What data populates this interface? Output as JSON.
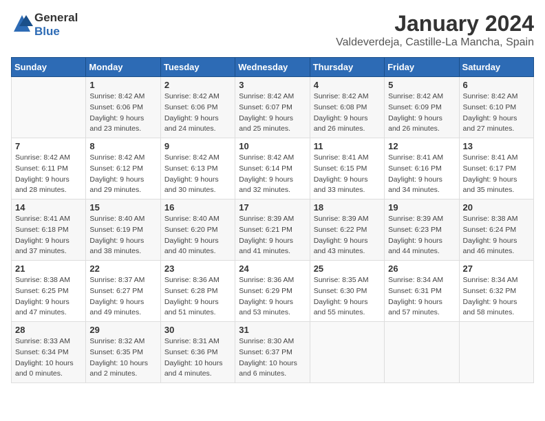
{
  "logo": {
    "text_general": "General",
    "text_blue": "Blue"
  },
  "title": "January 2024",
  "subtitle": "Valdeverdeja, Castille-La Mancha, Spain",
  "days_of_week": [
    "Sunday",
    "Monday",
    "Tuesday",
    "Wednesday",
    "Thursday",
    "Friday",
    "Saturday"
  ],
  "weeks": [
    [
      {
        "day": "",
        "sunrise": "",
        "sunset": "",
        "daylight": ""
      },
      {
        "day": "1",
        "sunrise": "Sunrise: 8:42 AM",
        "sunset": "Sunset: 6:06 PM",
        "daylight": "Daylight: 9 hours and 23 minutes."
      },
      {
        "day": "2",
        "sunrise": "Sunrise: 8:42 AM",
        "sunset": "Sunset: 6:06 PM",
        "daylight": "Daylight: 9 hours and 24 minutes."
      },
      {
        "day": "3",
        "sunrise": "Sunrise: 8:42 AM",
        "sunset": "Sunset: 6:07 PM",
        "daylight": "Daylight: 9 hours and 25 minutes."
      },
      {
        "day": "4",
        "sunrise": "Sunrise: 8:42 AM",
        "sunset": "Sunset: 6:08 PM",
        "daylight": "Daylight: 9 hours and 26 minutes."
      },
      {
        "day": "5",
        "sunrise": "Sunrise: 8:42 AM",
        "sunset": "Sunset: 6:09 PM",
        "daylight": "Daylight: 9 hours and 26 minutes."
      },
      {
        "day": "6",
        "sunrise": "Sunrise: 8:42 AM",
        "sunset": "Sunset: 6:10 PM",
        "daylight": "Daylight: 9 hours and 27 minutes."
      }
    ],
    [
      {
        "day": "7",
        "sunrise": "",
        "sunset": "",
        "daylight": ""
      },
      {
        "day": "8",
        "sunrise": "Sunrise: 8:42 AM",
        "sunset": "Sunset: 6:12 PM",
        "daylight": "Daylight: 9 hours and 29 minutes."
      },
      {
        "day": "9",
        "sunrise": "Sunrise: 8:42 AM",
        "sunset": "Sunset: 6:13 PM",
        "daylight": "Daylight: 9 hours and 30 minutes."
      },
      {
        "day": "10",
        "sunrise": "Sunrise: 8:42 AM",
        "sunset": "Sunset: 6:14 PM",
        "daylight": "Daylight: 9 hours and 32 minutes."
      },
      {
        "day": "11",
        "sunrise": "Sunrise: 8:41 AM",
        "sunset": "Sunset: 6:15 PM",
        "daylight": "Daylight: 9 hours and 33 minutes."
      },
      {
        "day": "12",
        "sunrise": "Sunrise: 8:41 AM",
        "sunset": "Sunset: 6:16 PM",
        "daylight": "Daylight: 9 hours and 34 minutes."
      },
      {
        "day": "13",
        "sunrise": "Sunrise: 8:41 AM",
        "sunset": "Sunset: 6:17 PM",
        "daylight": "Daylight: 9 hours and 35 minutes."
      }
    ],
    [
      {
        "day": "14",
        "sunrise": "Sunrise: 8:41 AM",
        "sunset": "Sunset: 6:18 PM",
        "daylight": "Daylight: 9 hours and 37 minutes."
      },
      {
        "day": "15",
        "sunrise": "Sunrise: 8:40 AM",
        "sunset": "Sunset: 6:19 PM",
        "daylight": "Daylight: 9 hours and 38 minutes."
      },
      {
        "day": "16",
        "sunrise": "Sunrise: 8:40 AM",
        "sunset": "Sunset: 6:20 PM",
        "daylight": "Daylight: 9 hours and 40 minutes."
      },
      {
        "day": "17",
        "sunrise": "Sunrise: 8:39 AM",
        "sunset": "Sunset: 6:21 PM",
        "daylight": "Daylight: 9 hours and 41 minutes."
      },
      {
        "day": "18",
        "sunrise": "Sunrise: 8:39 AM",
        "sunset": "Sunset: 6:22 PM",
        "daylight": "Daylight: 9 hours and 43 minutes."
      },
      {
        "day": "19",
        "sunrise": "Sunrise: 8:39 AM",
        "sunset": "Sunset: 6:23 PM",
        "daylight": "Daylight: 9 hours and 44 minutes."
      },
      {
        "day": "20",
        "sunrise": "Sunrise: 8:38 AM",
        "sunset": "Sunset: 6:24 PM",
        "daylight": "Daylight: 9 hours and 46 minutes."
      }
    ],
    [
      {
        "day": "21",
        "sunrise": "Sunrise: 8:38 AM",
        "sunset": "Sunset: 6:25 PM",
        "daylight": "Daylight: 9 hours and 47 minutes."
      },
      {
        "day": "22",
        "sunrise": "Sunrise: 8:37 AM",
        "sunset": "Sunset: 6:27 PM",
        "daylight": "Daylight: 9 hours and 49 minutes."
      },
      {
        "day": "23",
        "sunrise": "Sunrise: 8:36 AM",
        "sunset": "Sunset: 6:28 PM",
        "daylight": "Daylight: 9 hours and 51 minutes."
      },
      {
        "day": "24",
        "sunrise": "Sunrise: 8:36 AM",
        "sunset": "Sunset: 6:29 PM",
        "daylight": "Daylight: 9 hours and 53 minutes."
      },
      {
        "day": "25",
        "sunrise": "Sunrise: 8:35 AM",
        "sunset": "Sunset: 6:30 PM",
        "daylight": "Daylight: 9 hours and 55 minutes."
      },
      {
        "day": "26",
        "sunrise": "Sunrise: 8:34 AM",
        "sunset": "Sunset: 6:31 PM",
        "daylight": "Daylight: 9 hours and 57 minutes."
      },
      {
        "day": "27",
        "sunrise": "Sunrise: 8:34 AM",
        "sunset": "Sunset: 6:32 PM",
        "daylight": "Daylight: 9 hours and 58 minutes."
      }
    ],
    [
      {
        "day": "28",
        "sunrise": "Sunrise: 8:33 AM",
        "sunset": "Sunset: 6:34 PM",
        "daylight": "Daylight: 10 hours and 0 minutes."
      },
      {
        "day": "29",
        "sunrise": "Sunrise: 8:32 AM",
        "sunset": "Sunset: 6:35 PM",
        "daylight": "Daylight: 10 hours and 2 minutes."
      },
      {
        "day": "30",
        "sunrise": "Sunrise: 8:31 AM",
        "sunset": "Sunset: 6:36 PM",
        "daylight": "Daylight: 10 hours and 4 minutes."
      },
      {
        "day": "31",
        "sunrise": "Sunrise: 8:30 AM",
        "sunset": "Sunset: 6:37 PM",
        "daylight": "Daylight: 10 hours and 6 minutes."
      },
      {
        "day": "",
        "sunrise": "",
        "sunset": "",
        "daylight": ""
      },
      {
        "day": "",
        "sunrise": "",
        "sunset": "",
        "daylight": ""
      },
      {
        "day": "",
        "sunrise": "",
        "sunset": "",
        "daylight": ""
      }
    ]
  ],
  "week1_sun": {
    "sunrise": "Sunrise: 8:42 AM",
    "sunset": "Sunset: 6:11 PM",
    "daylight": "Daylight: 9 hours and 28 minutes."
  }
}
